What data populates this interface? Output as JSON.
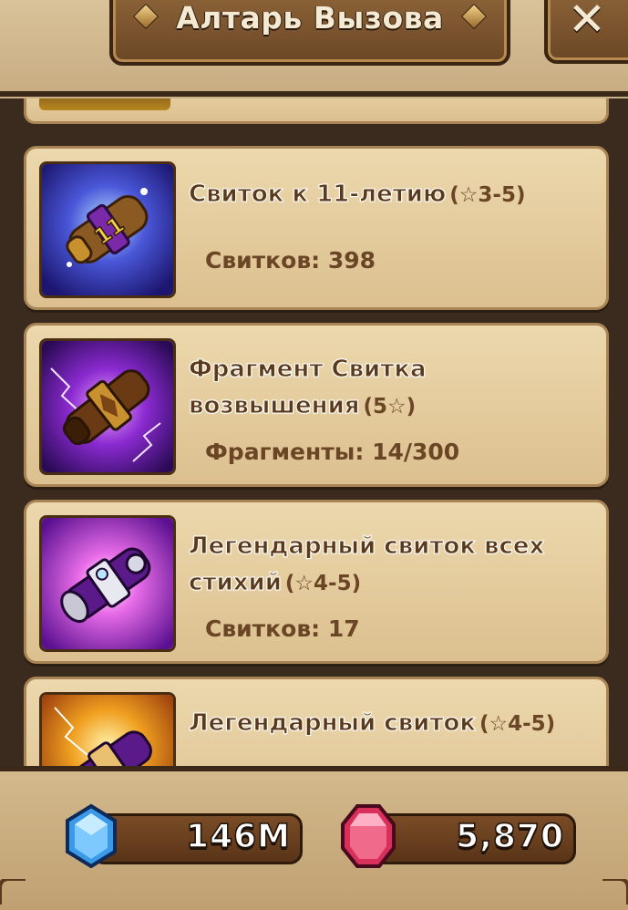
{
  "window": {
    "title": "Алтарь Вызова",
    "close_label": "✕"
  },
  "scrolls": [
    {
      "icon": "anniversary-scroll-icon",
      "name": "Свиток к 11-летию",
      "grade": "(☆3-5)",
      "count_label": "Свитков: 398"
    },
    {
      "icon": "transcendence-scroll-fragment-icon",
      "name_line1": "Фрагмент Свитка",
      "name_line2": "возвышения",
      "grade": "(5☆)",
      "count_label": "Фрагменты: 14/300"
    },
    {
      "icon": "legendary-all-attribute-scroll-icon",
      "name_line1": "Легендарный свиток всех",
      "name_line2": "стихий",
      "grade": "(☆4-5)",
      "count_label": "Свитков: 17"
    },
    {
      "icon": "legendary-scroll-icon",
      "name": "Легендарный свиток",
      "grade": "(☆4-5)"
    }
  ],
  "currencies": {
    "crystals": {
      "icon": "blue-crystal-icon",
      "value": "146M"
    },
    "rubies": {
      "icon": "red-ruby-icon",
      "value": "5,870"
    }
  },
  "colors": {
    "card_bg": "#e6cfa1",
    "frame_dark": "#3b2a1e",
    "text_brown": "#5b3a1c"
  }
}
